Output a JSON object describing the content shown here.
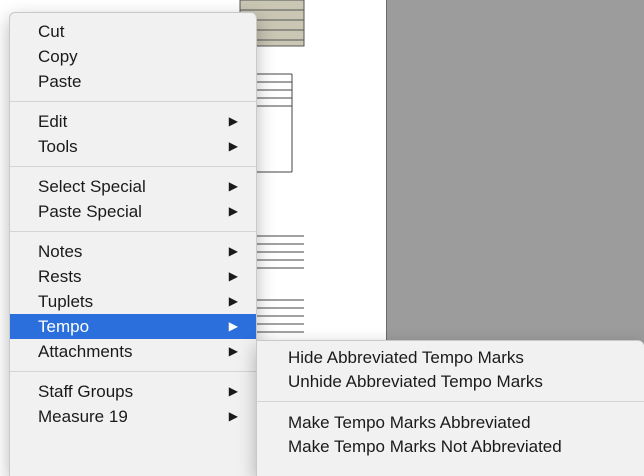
{
  "context_menu": {
    "groups": [
      [
        {
          "label": "Cut",
          "has_submenu": false
        },
        {
          "label": "Copy",
          "has_submenu": false
        },
        {
          "label": "Paste",
          "has_submenu": false
        }
      ],
      [
        {
          "label": "Edit",
          "has_submenu": true
        },
        {
          "label": "Tools",
          "has_submenu": true
        }
      ],
      [
        {
          "label": "Select Special",
          "has_submenu": true
        },
        {
          "label": "Paste Special",
          "has_submenu": true
        }
      ],
      [
        {
          "label": "Notes",
          "has_submenu": true
        },
        {
          "label": "Rests",
          "has_submenu": true
        },
        {
          "label": "Tuplets",
          "has_submenu": true
        },
        {
          "label": "Tempo",
          "has_submenu": true,
          "highlighted": true
        },
        {
          "label": "Attachments",
          "has_submenu": true
        }
      ],
      [
        {
          "label": "Staff Groups",
          "has_submenu": true
        },
        {
          "label": "Measure 19",
          "has_submenu": true
        }
      ]
    ],
    "submenu_arrow": "▶"
  },
  "tempo_submenu": {
    "groups": [
      [
        {
          "label": "Hide Abbreviated Tempo Marks"
        },
        {
          "label": "Unhide Abbreviated Tempo Marks"
        }
      ],
      [
        {
          "label": "Make Tempo Marks Abbreviated"
        },
        {
          "label": "Make Tempo Marks Not Abbreviated"
        }
      ]
    ]
  },
  "colors": {
    "highlight": "#2a6fdc",
    "menu_background": "#f1f1f1",
    "editor_gray": "#9c9c9c"
  }
}
